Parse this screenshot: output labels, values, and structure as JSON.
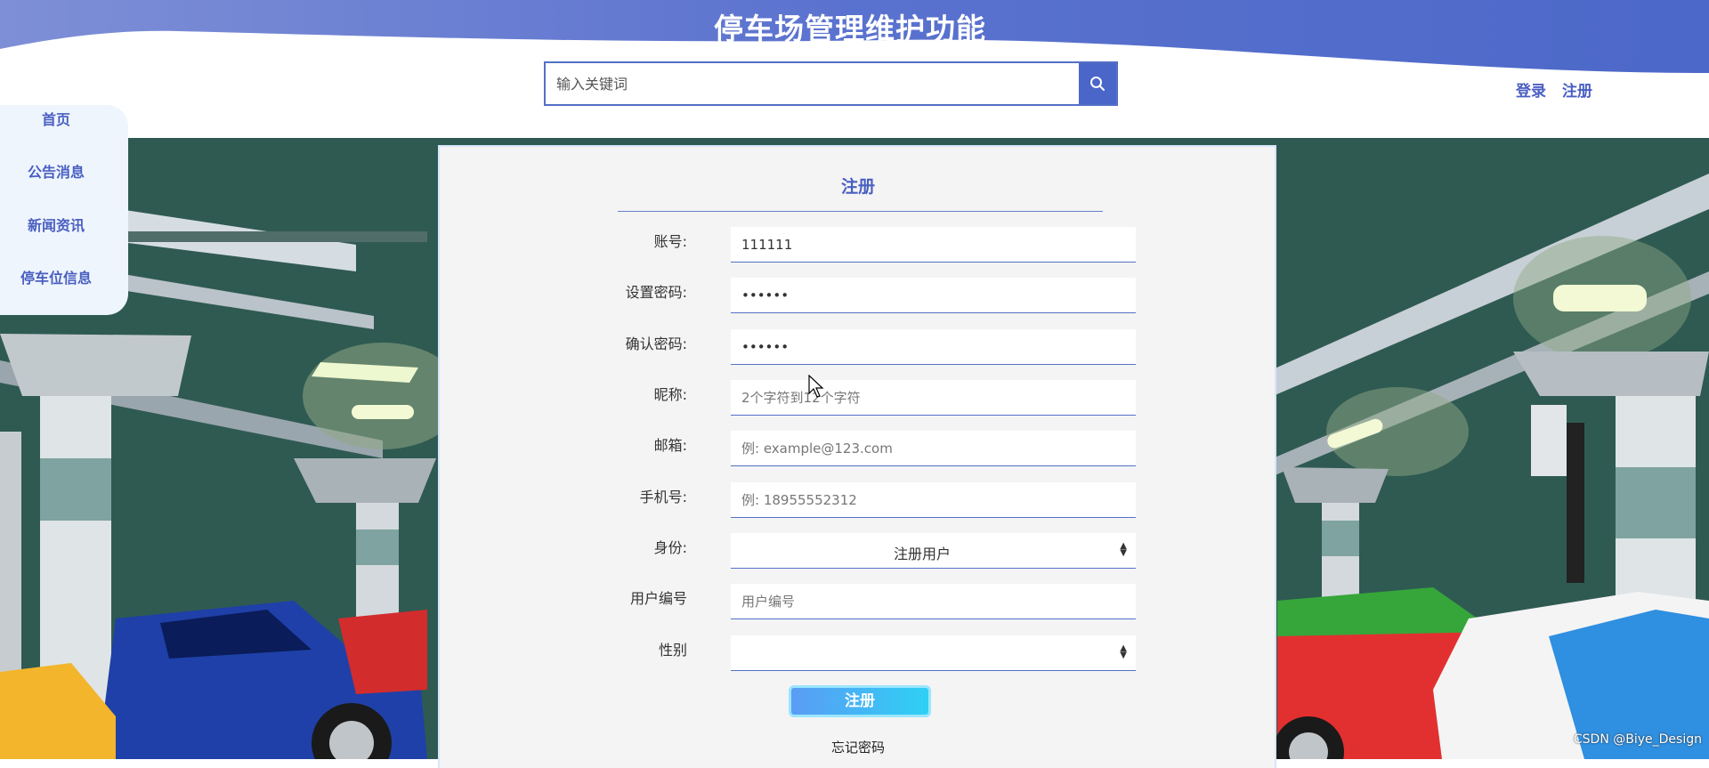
{
  "header": {
    "title": "停车场管理维护功能",
    "search_placeholder": "输入关键词",
    "search_icon": "search-icon",
    "login_label": "登录",
    "register_label": "注册"
  },
  "sidebar": {
    "items": [
      {
        "label": "首页"
      },
      {
        "label": "公告消息"
      },
      {
        "label": "新闻资讯"
      },
      {
        "label": "停车位信息"
      }
    ]
  },
  "form": {
    "title": "注册",
    "fields": [
      {
        "label": "账号:",
        "value": "111111",
        "placeholder": ""
      },
      {
        "label": "设置密码:",
        "value": "••••••",
        "placeholder": ""
      },
      {
        "label": "确认密码:",
        "value": "••••••",
        "placeholder": ""
      },
      {
        "label": "昵称:",
        "value": "",
        "placeholder": "2个字符到12个字符"
      },
      {
        "label": "邮箱:",
        "value": "",
        "placeholder": "例: example@123.com"
      },
      {
        "label": "手机号:",
        "value": "",
        "placeholder": "例: 18955552312"
      },
      {
        "label": "身份:",
        "value": "注册用户"
      },
      {
        "label": "用户编号",
        "value": "",
        "placeholder": "用户编号"
      },
      {
        "label": "性别",
        "value": ""
      }
    ],
    "submit_label": "注册",
    "forgot_label": "忘记密码"
  },
  "watermark": "CSDN @Biye_Design",
  "colors": {
    "accent": "#4a5fc1",
    "header_blue": "#5470c6",
    "button_gradient_start": "#5a9cf5",
    "button_gradient_end": "#2fd0f5",
    "panel_bg": "#f4f4f4"
  }
}
